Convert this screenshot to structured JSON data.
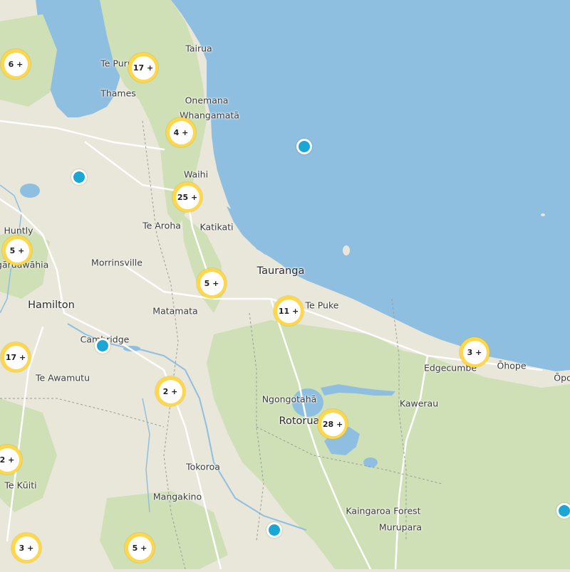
{
  "places": [
    {
      "id": "tairua",
      "name": "Tairua"
    },
    {
      "id": "te-puru",
      "name": "Te Puru"
    },
    {
      "id": "thames",
      "name": "Thames"
    },
    {
      "id": "onemana",
      "name": "Onemana"
    },
    {
      "id": "whangamata",
      "name": "Whangamatā"
    },
    {
      "id": "waihi",
      "name": "Waihi"
    },
    {
      "id": "te-aroha",
      "name": "Te Aroha"
    },
    {
      "id": "katikati",
      "name": "Katikati"
    },
    {
      "id": "huntly",
      "name": "Huntly"
    },
    {
      "id": "ngaruawahia",
      "name": "Ngāruawāhia"
    },
    {
      "id": "morrinsville",
      "name": "Morrinsville"
    },
    {
      "id": "tauranga",
      "name": "Tauranga"
    },
    {
      "id": "hamilton",
      "name": "Hamilton"
    },
    {
      "id": "matamata",
      "name": "Matamata"
    },
    {
      "id": "te-puke",
      "name": "Te Puke"
    },
    {
      "id": "cambridge",
      "name": "Cambridge"
    },
    {
      "id": "te-awamutu",
      "name": "Te Awamutu"
    },
    {
      "id": "edgecumbe",
      "name": "Edgecumbe"
    },
    {
      "id": "ohope",
      "name": "Ōhope"
    },
    {
      "id": "opotiki",
      "name": "Ōpo"
    },
    {
      "id": "ngongotaha",
      "name": "Ngongotahā"
    },
    {
      "id": "kawerau",
      "name": "Kawerau"
    },
    {
      "id": "rotorua",
      "name": "Rotorua"
    },
    {
      "id": "tokoroa",
      "name": "Tokoroa"
    },
    {
      "id": "te-kuiti",
      "name": "Te Kūiti"
    },
    {
      "id": "mangakino",
      "name": "Mangakino"
    },
    {
      "id": "kaingaroa",
      "name": "Kaingaroa Forest"
    },
    {
      "id": "murupara",
      "name": "Murupara"
    }
  ],
  "clusters": [
    {
      "id": "c1",
      "label": "6 +"
    },
    {
      "id": "c2",
      "label": "17 +"
    },
    {
      "id": "c3",
      "label": "4 +"
    },
    {
      "id": "c4",
      "label": "25 +"
    },
    {
      "id": "c5",
      "label": "5 +"
    },
    {
      "id": "c6",
      "label": "5 +"
    },
    {
      "id": "c7",
      "label": "11 +"
    },
    {
      "id": "c8",
      "label": "17 +"
    },
    {
      "id": "c9",
      "label": "3 +"
    },
    {
      "id": "c10",
      "label": "2 +"
    },
    {
      "id": "c11",
      "label": "28 +"
    },
    {
      "id": "c12",
      "label": "2 +"
    },
    {
      "id": "c13",
      "label": "3 +"
    },
    {
      "id": "c14",
      "label": "5 +"
    }
  ],
  "markers": [
    "m1",
    "m2",
    "m3",
    "m4",
    "m5"
  ],
  "colors": {
    "sea": "#8fbfe0",
    "land": "#e9e7da",
    "forest": "#cfe0b6",
    "lake": "#8fbfe0",
    "cluster_ring": "#ffd84a",
    "marker": "#1aa7d6"
  }
}
